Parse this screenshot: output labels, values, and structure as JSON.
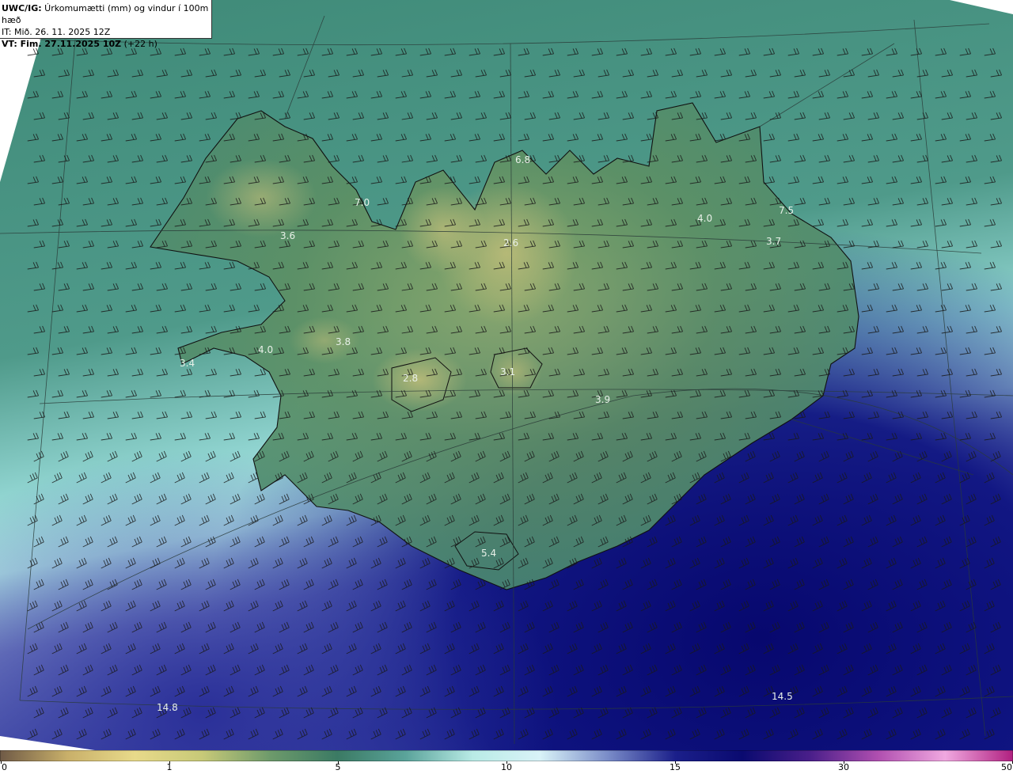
{
  "header": {
    "product": "UWC/IG:",
    "description": " Úrkomumætti (mm) og vindur í 100m hæð",
    "it_line": "IT: Mið. 26. 11. 2025 12Z",
    "vt_prefix": "VT: Fim. 27.11.2025 10Z",
    "vt_suffix": " (+22 h)"
  },
  "colorbar": {
    "ticks": [
      {
        "label": "0",
        "value": 0,
        "frac": 0.0
      },
      {
        "label": "1",
        "value": 1,
        "frac": 0.167
      },
      {
        "label": "5",
        "value": 5,
        "frac": 0.333
      },
      {
        "label": "10",
        "value": 10,
        "frac": 0.5
      },
      {
        "label": "15",
        "value": 15,
        "frac": 0.667
      },
      {
        "label": "30",
        "value": 30,
        "frac": 0.833
      },
      {
        "label": "50",
        "value": 50,
        "frac": 1.0
      }
    ],
    "colors": [
      "#6f5a46",
      "#c9b06a",
      "#e8da8a",
      "#c7c978",
      "#6d9a6b",
      "#3b7a64",
      "#5aa39a",
      "#b9ebe6",
      "#d9f3f8",
      "#7a8cc8",
      "#1b1f8a",
      "#0a0a70",
      "#4a1f8a",
      "#b04fb0",
      "#f0a8e0",
      "#b02080"
    ]
  },
  "labels": [
    {
      "text": "6.8"
    },
    {
      "text": "7.0"
    },
    {
      "text": "3.6"
    },
    {
      "text": "2.6"
    },
    {
      "text": "4.0"
    },
    {
      "text": "7.5"
    },
    {
      "text": "3.7"
    },
    {
      "text": "4.0"
    },
    {
      "text": "3.8"
    },
    {
      "text": "3.4"
    },
    {
      "text": "2.8"
    },
    {
      "text": "3.1"
    },
    {
      "text": "3.9"
    },
    {
      "text": "5.4"
    },
    {
      "text": "14.8"
    },
    {
      "text": "14.5"
    }
  ]
}
